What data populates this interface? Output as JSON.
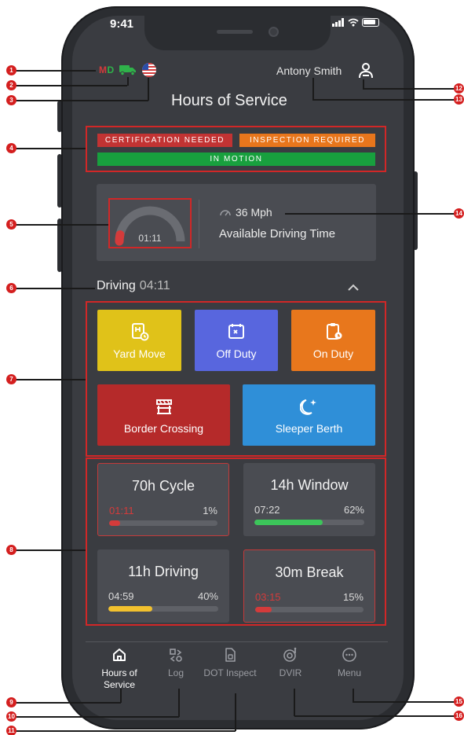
{
  "status_bar": {
    "time": "9:41"
  },
  "header": {
    "md_m": "M",
    "md_d": "D",
    "user_name": "Antony Smith",
    "title": "Hours of Service"
  },
  "alerts": {
    "certification": {
      "label": "CERTIFICATION NEEDED",
      "color": "#c23333"
    },
    "inspection": {
      "label": "INSPECTION REQUIRED",
      "color": "#e8761c"
    },
    "motion": {
      "label": "IN MOTION",
      "color": "#18a03e"
    }
  },
  "speed_card": {
    "gauge_time": "01:11",
    "gauge_level": 0.07,
    "speed": "36 Mph",
    "label": "Available Driving Time"
  },
  "driving": {
    "label": "Driving",
    "time": "04:11"
  },
  "duty_buttons": [
    {
      "label": "Yard Move",
      "color": "#e0c219",
      "icon": "yard-move-icon"
    },
    {
      "label": "Off Duty",
      "color": "#5866de",
      "icon": "off-duty-icon"
    },
    {
      "label": "On Duty",
      "color": "#e8771c",
      "icon": "on-duty-icon"
    },
    {
      "label": "Border Crossing",
      "color": "#b52a2a",
      "icon": "border-crossing-icon"
    },
    {
      "label": "Sleeper Berth",
      "color": "#2f8fd8",
      "icon": "sleeper-berth-icon"
    }
  ],
  "timers": [
    {
      "title": "70h Cycle",
      "time": "01:11",
      "percent": "1%",
      "fill": 0.1,
      "bar_color": "#d33b3b",
      "time_color": "#d33b3b",
      "alert": true
    },
    {
      "title": "14h Window",
      "time": "07:22",
      "percent": "62%",
      "fill": 0.62,
      "bar_color": "#3cc55a",
      "time_color": "#d9d9d9",
      "alert": false
    },
    {
      "title": "11h Driving",
      "time": "04:59",
      "percent": "40%",
      "fill": 0.4,
      "bar_color": "#f2c12e",
      "time_color": "#d9d9d9",
      "alert": false
    },
    {
      "title": "30m Break",
      "time": "03:15",
      "percent": "15%",
      "fill": 0.15,
      "bar_color": "#d33b3b",
      "time_color": "#d33b3b",
      "alert": true
    }
  ],
  "nav": [
    {
      "label": "Hours of Service",
      "icon": "home-icon",
      "active": true
    },
    {
      "label": "Log",
      "icon": "log-icon",
      "active": false
    },
    {
      "label": "DOT Inspect",
      "icon": "dot-inspect-icon",
      "active": false
    },
    {
      "label": "DVIR",
      "icon": "dvir-icon",
      "active": false
    },
    {
      "label": "Menu",
      "icon": "menu-icon",
      "active": false
    }
  ],
  "callouts": [
    "1",
    "2",
    "3",
    "4",
    "5",
    "6",
    "7",
    "8",
    "9",
    "10",
    "11",
    "12",
    "13",
    "14",
    "15",
    "16"
  ]
}
